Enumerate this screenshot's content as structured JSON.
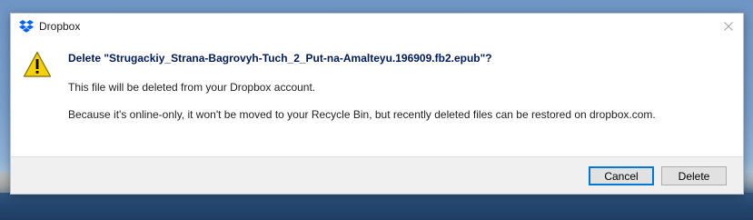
{
  "window": {
    "app_name": "Dropbox",
    "app_icon": "dropbox-logo-icon",
    "close_icon": "close-icon"
  },
  "dialog": {
    "icon": "warning-icon",
    "heading": "Delete \"Strugackiy_Strana-Bagrovyh-Tuch_2_Put-na-Amalteyu.196909.fb2.epub\"?",
    "message_line_1": "This file will be deleted from your Dropbox account.",
    "message_line_2": "Because it's online-only, it won't be moved to your Recycle Bin, but recently deleted files can be restored on dropbox.com."
  },
  "buttons": {
    "cancel": "Cancel",
    "delete": "Delete"
  },
  "colors": {
    "dropbox_blue": "#0061fe",
    "warning_yellow": "#f6d100",
    "heading_text": "#001b5a",
    "focus_border": "#0078d7"
  }
}
